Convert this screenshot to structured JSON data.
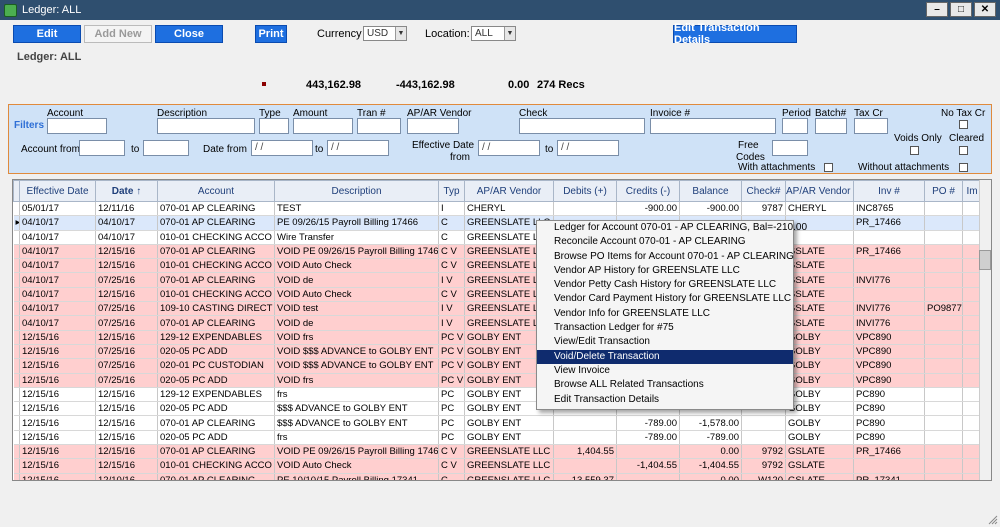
{
  "window": {
    "title": "Ledger: ALL"
  },
  "toolbar": {
    "edit": "Edit",
    "add_new": "Add New",
    "close": "Close",
    "print": "Print",
    "currency_label": "Currency",
    "currency_value": "USD",
    "location_label": "Location:",
    "location_value": "ALL",
    "details": "Edit Transaction Details"
  },
  "ledger_heading": "Ledger: ALL",
  "summary": {
    "debits": "443,162.98",
    "credits": "-443,162.98",
    "balance": "0.00",
    "recs": "274 Recs"
  },
  "filters": {
    "title": "Filters",
    "account": "Account",
    "description": "Description",
    "type": "Type",
    "amount": "Amount",
    "tran": "Tran #",
    "vendor": "AP/AR Vendor",
    "check": "Check",
    "invoice": "Invoice #",
    "period": "Period",
    "batch": "Batch#",
    "taxcr": "Tax Cr",
    "notaxcr": "No Tax Cr",
    "voidsonly": "Voids Only",
    "cleared": "Cleared",
    "account_from": "Account from",
    "to": "to",
    "date_from": "Date from",
    "date_placeholder": " /  /",
    "eff_date_from_1": "Effective Date",
    "eff_date_from_2": "from",
    "free_codes_1": "Free",
    "free_codes_2": "Codes",
    "with_attach": "With attachments",
    "without_attach": "Without attachments"
  },
  "columns": [
    "Effective Date",
    "Date ↑",
    "Account",
    "Description",
    "Typ",
    "AP/AR Vendor",
    "Debits (+)",
    "Credits (-)",
    "Balance",
    "Check#",
    "AP/AR Vendor C",
    "Inv #",
    "PO #",
    "Im"
  ],
  "rows": [
    {
      "s": "w",
      "c": [
        "05/01/17",
        "12/11/16",
        "070-01  AP CLEARING",
        "TEST",
        "I",
        "CHERYL",
        "",
        "-900.00",
        "-900.00",
        "9787",
        "CHERYL",
        "INC8765",
        "",
        ""
      ]
    },
    {
      "s": "sel",
      "c": [
        "04/10/17",
        "04/10/17",
        "070-01  AP CLEARING",
        "PE 09/26/15 Payroll Billing 17466",
        "C",
        "GREENSLATE LLC",
        "",
        "",
        "",
        "",
        "",
        "PR_17466",
        "",
        ""
      ]
    },
    {
      "s": "w",
      "c": [
        "04/10/17",
        "04/10/17",
        "010-01  CHECKING ACCO",
        "Wire Transfer",
        "C",
        "GREENSLATE LLC",
        "",
        "",
        "",
        "",
        "",
        "",
        "",
        ""
      ]
    },
    {
      "s": "p",
      "c": [
        "04/10/17",
        "12/15/16",
        "070-01  AP CLEARING",
        "VOID PE 09/26/15 Payroll Billing 17466",
        "C V",
        "GREENSLATE LLC",
        "",
        "",
        "",
        "",
        "GSLATE",
        "PR_17466",
        "",
        ""
      ]
    },
    {
      "s": "p",
      "c": [
        "04/10/17",
        "12/15/16",
        "010-01  CHECKING ACCO",
        "VOID Auto Check",
        "C V",
        "GREENSLATE LLC",
        "",
        "",
        "",
        "",
        "GSLATE",
        "",
        "",
        ""
      ]
    },
    {
      "s": "p",
      "c": [
        "04/10/17",
        "07/25/16",
        "070-01  AP CLEARING",
        "VOID de",
        "I V",
        "GREENSLATE LLC",
        "",
        "",
        "",
        "",
        "GSLATE",
        "INVI776",
        "",
        ""
      ]
    },
    {
      "s": "p",
      "c": [
        "04/10/17",
        "12/15/16",
        "010-01  CHECKING ACCO",
        "VOID Auto Check",
        "C V",
        "GREENSLATE LLC",
        "",
        "",
        "",
        "",
        "GSLATE",
        "",
        "",
        ""
      ]
    },
    {
      "s": "p",
      "c": [
        "04/10/17",
        "07/25/16",
        "109-10  CASTING DIRECT",
        "VOID test",
        "I V",
        "GREENSLATE LLC",
        "",
        "",
        "",
        "",
        "GSLATE",
        "INVI776",
        "PO9877",
        ""
      ]
    },
    {
      "s": "p",
      "c": [
        "04/10/17",
        "07/25/16",
        "070-01  AP CLEARING",
        "VOID de",
        "I V",
        "GREENSLATE LLC",
        "",
        "",
        "",
        "",
        "GSLATE",
        "INVI776",
        "",
        ""
      ]
    },
    {
      "s": "p",
      "c": [
        "12/15/16",
        "12/15/16",
        "129-12  EXPENDABLES",
        "VOID frs",
        "PC V",
        "GOLBY ENT",
        "",
        "",
        "",
        "",
        "GOLBY",
        "VPC890",
        "",
        ""
      ]
    },
    {
      "s": "p",
      "c": [
        "12/15/16",
        "07/25/16",
        "020-05  PC ADD",
        "VOID $$$ ADVANCE to GOLBY ENT",
        "PC V",
        "GOLBY ENT",
        "",
        "",
        "",
        "",
        "GOLBY",
        "VPC890",
        "",
        ""
      ]
    },
    {
      "s": "p",
      "c": [
        "12/15/16",
        "07/25/16",
        "020-01  PC CUSTODIAN",
        "VOID $$$ ADVANCE to GOLBY ENT",
        "PC V",
        "GOLBY ENT",
        "",
        "",
        "",
        "",
        "GOLBY",
        "VPC890",
        "",
        ""
      ]
    },
    {
      "s": "p",
      "c": [
        "12/15/16",
        "07/25/16",
        "020-05  PC ADD",
        "VOID frs",
        "PC V",
        "GOLBY ENT",
        "",
        "",
        "",
        "",
        "GOLBY",
        "VPC890",
        "",
        ""
      ]
    },
    {
      "s": "w",
      "c": [
        "12/15/16",
        "12/15/16",
        "129-12  EXPENDABLES",
        "frs",
        "PC",
        "GOLBY ENT",
        "",
        "",
        "",
        "",
        "GOLBY",
        "PC890",
        "",
        ""
      ]
    },
    {
      "s": "w",
      "c": [
        "12/15/16",
        "12/15/16",
        "020-05  PC ADD",
        "$$$ ADVANCE to GOLBY ENT",
        "PC",
        "GOLBY ENT",
        "",
        "",
        "",
        "",
        "GOLBY",
        "PC890",
        "",
        ""
      ]
    },
    {
      "s": "w",
      "c": [
        "12/15/16",
        "12/15/16",
        "070-01  AP CLEARING",
        "$$$ ADVANCE to GOLBY ENT",
        "PC",
        "GOLBY ENT",
        "",
        "-789.00",
        "-1,578.00",
        "",
        "GOLBY",
        "PC890",
        "",
        ""
      ]
    },
    {
      "s": "w",
      "c": [
        "12/15/16",
        "12/15/16",
        "020-05  PC ADD",
        "frs",
        "PC",
        "GOLBY ENT",
        "",
        "-789.00",
        "-789.00",
        "",
        "GOLBY",
        "PC890",
        "",
        ""
      ]
    },
    {
      "s": "p",
      "c": [
        "12/15/16",
        "12/15/16",
        "070-01  AP CLEARING",
        "VOID PE 09/26/15 Payroll Billing 17466",
        "C V",
        "GREENSLATE LLC",
        "1,404.55",
        "",
        "0.00",
        "9792",
        "GSLATE",
        "PR_17466",
        "",
        ""
      ]
    },
    {
      "s": "p",
      "c": [
        "12/15/16",
        "12/15/16",
        "010-01  CHECKING ACCO",
        "VOID Auto Check",
        "C V",
        "GREENSLATE LLC",
        "",
        "-1,404.55",
        "-1,404.55",
        "9792",
        "GSLATE",
        "",
        "",
        ""
      ]
    },
    {
      "s": "p",
      "c": [
        "12/15/16",
        "12/10/16",
        "070-01  AP CLEARING",
        "PE 10/10/15 Payroll Billing 17341",
        "C",
        "GREENSLATE LLC",
        "13,559.37",
        "",
        "0.00",
        "W120",
        "GSLATE",
        "PR_17341",
        "",
        ""
      ]
    }
  ],
  "context_menu": {
    "items": [
      "Ledger for Account 070-01 - AP CLEARING,  Bal=-210.00",
      "Reconcile Account 070-01 - AP CLEARING",
      "Browse PO Items for Account 070-01 - AP CLEARING",
      "Vendor AP History for GREENSLATE LLC",
      "Vendor Petty Cash History for GREENSLATE LLC",
      "Vendor Card Payment History for GREENSLATE LLC",
      "Vendor Info for GREENSLATE LLC",
      "Transaction Ledger for #75",
      "View/Edit Transaction",
      "Void/Delete Transaction",
      "View Invoice",
      "Browse ALL Related Transactions",
      "Edit Transaction Details"
    ],
    "highlighted_index": 9
  },
  "colors": {
    "void_row": "#ffcfcf",
    "selected_row": "#dbe8fb",
    "button_blue": "#1e6fe0",
    "filter_bg": "#cfe2f7",
    "menu_highlight": "#0f2b6e"
  }
}
